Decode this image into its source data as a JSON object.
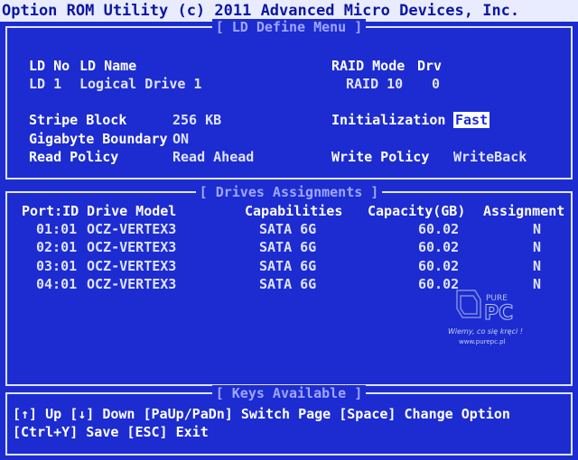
{
  "title": "Option ROM Utility (c) 2011 Advanced Micro Devices, Inc.",
  "ld_menu": {
    "title": "[ LD Define Menu ]",
    "headers": {
      "ld_no": "LD No",
      "ld_name": "LD Name",
      "raid_mode": "RAID Mode",
      "drv": "Drv"
    },
    "values": {
      "ld_no": "LD  1",
      "ld_name": "Logical Drive 1",
      "raid_mode": "RAID 10",
      "drv": "0"
    },
    "stripe_block_label": "Stripe Block",
    "stripe_block_value": "256 KB",
    "gigabyte_boundary_label": "Gigabyte Boundary",
    "gigabyte_boundary_value": "ON",
    "read_policy_label": "Read Policy",
    "read_policy_value": "Read Ahead",
    "initialization_label": "Initialization",
    "initialization_value": "Fast",
    "write_policy_label": "Write Policy",
    "write_policy_value": "WriteBack"
  },
  "drives": {
    "title": "[ Drives Assignments ]",
    "columns": [
      "Port:ID",
      "Drive Model",
      "Capabilities",
      "Capacity(GB)",
      "Assignment"
    ],
    "rows": [
      [
        "01:01",
        "OCZ-VERTEX3",
        "SATA 6G",
        "60.02",
        "N"
      ],
      [
        "02:01",
        "OCZ-VERTEX3",
        "SATA 6G",
        "60.02",
        "N"
      ],
      [
        "03:01",
        "OCZ-VERTEX3",
        "SATA 6G",
        "60.02",
        "N"
      ],
      [
        "04:01",
        "OCZ-VERTEX3",
        "SATA 6G",
        "60.02",
        "N"
      ]
    ]
  },
  "keys": {
    "title": "[ Keys Available ]",
    "line1": "[↑] Up  [↓] Down  [PaUp/PaDn] Switch Page  [Space] Change Option",
    "line2": "[Ctrl+Y] Save  [ESC] Exit"
  },
  "watermark": {
    "brand": "PURE PC",
    "tagline": "Wiemy, co się kręci !",
    "url": "www.purepc.pl"
  }
}
